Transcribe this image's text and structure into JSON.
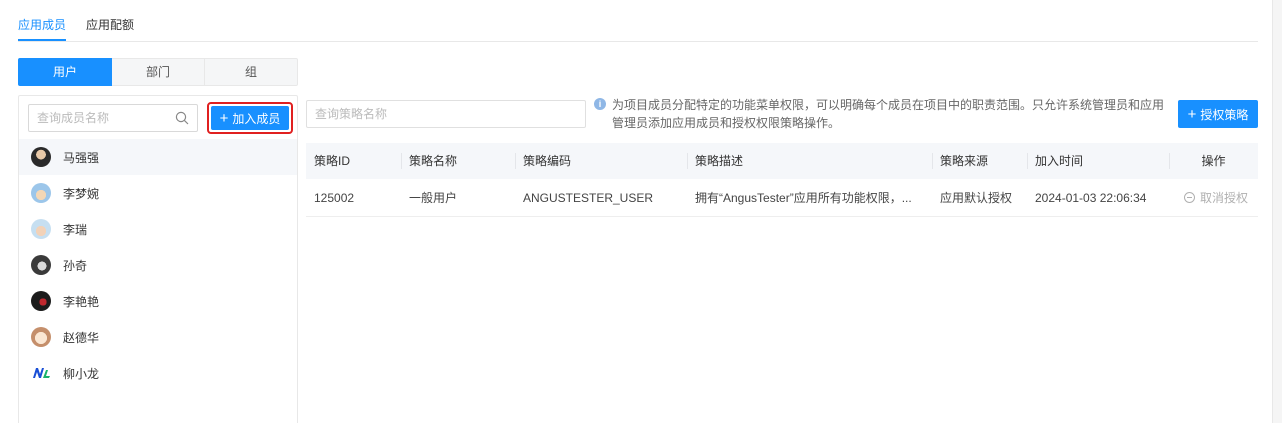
{
  "top_tabs": [
    {
      "label": "应用成员",
      "active": true
    },
    {
      "label": "应用配额",
      "active": false
    }
  ],
  "segments": [
    {
      "label": "用户",
      "active": true
    },
    {
      "label": "部门",
      "active": false
    },
    {
      "label": "组",
      "active": false
    }
  ],
  "member_search": {
    "placeholder": "查询成员名称",
    "value": ""
  },
  "add_member_label": "加入成员",
  "members": [
    {
      "name": "马强强",
      "selected": true
    },
    {
      "name": "李梦婉",
      "selected": false
    },
    {
      "name": "李瑞",
      "selected": false
    },
    {
      "name": "孙奇",
      "selected": false
    },
    {
      "name": "李艳艳",
      "selected": false
    },
    {
      "name": "赵德华",
      "selected": false
    },
    {
      "name": "柳小龙",
      "selected": false
    }
  ],
  "policy_search": {
    "placeholder": "查询策略名称",
    "value": ""
  },
  "hint_text": "为项目成员分配特定的功能菜单权限，可以明确每个成员在项目中的职责范围。只允许系统管理员和应用管理员添加应用成员和授权权限策略操作。",
  "grant_label": "授权策略",
  "table": {
    "columns": [
      "策略ID",
      "策略名称",
      "策略编码",
      "策略描述",
      "策略来源",
      "加入时间",
      "操作"
    ],
    "rows": [
      {
        "id": "125002",
        "name": "一般用户",
        "code": "ANGUSTESTER_USER",
        "description": "拥有“AngusTester”应用所有功能权限，...",
        "source": "应用默认授权",
        "joined": "2024-01-03 22:06:34",
        "action": "取消授权"
      }
    ]
  },
  "colors": {
    "primary": "#1890ff",
    "highlight_border": "#e02020",
    "header_bg": "#f5f7fa",
    "disabled_text": "#b0b0b0"
  }
}
